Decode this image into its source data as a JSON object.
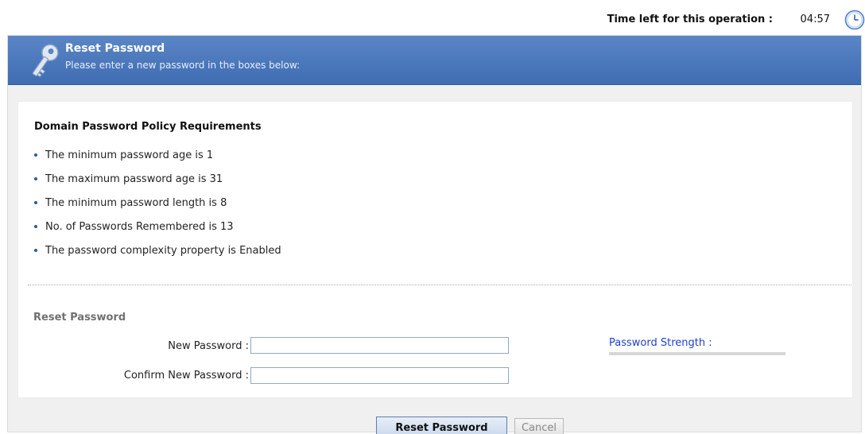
{
  "timer": {
    "label": "Time left for this operation :",
    "value": "04:57",
    "icon": "clock-icon"
  },
  "header": {
    "title": "Reset Password",
    "subtitle": "Please enter a new password in the boxes below:",
    "icon": "key-icon"
  },
  "policy": {
    "title": "Domain Password Policy Requirements",
    "items": [
      "The minimum password age is 1",
      "The maximum password age is 31",
      "The minimum password length is 8",
      "No. of Passwords Remembered is 13",
      "The password complexity property is Enabled"
    ]
  },
  "form": {
    "section_label": "Reset Password",
    "new_password_label": "New Password :",
    "new_password_value": "",
    "confirm_password_label": "Confirm New Password :",
    "confirm_password_value": "",
    "strength_label": "Password Strength :",
    "strength_level": 0
  },
  "buttons": {
    "reset_label": "Reset Password",
    "cancel_label": "Cancel"
  },
  "colors": {
    "header_blue": "#3f6db2",
    "bullet_blue": "#2a5ba3",
    "strength_text": "#2040c8"
  }
}
